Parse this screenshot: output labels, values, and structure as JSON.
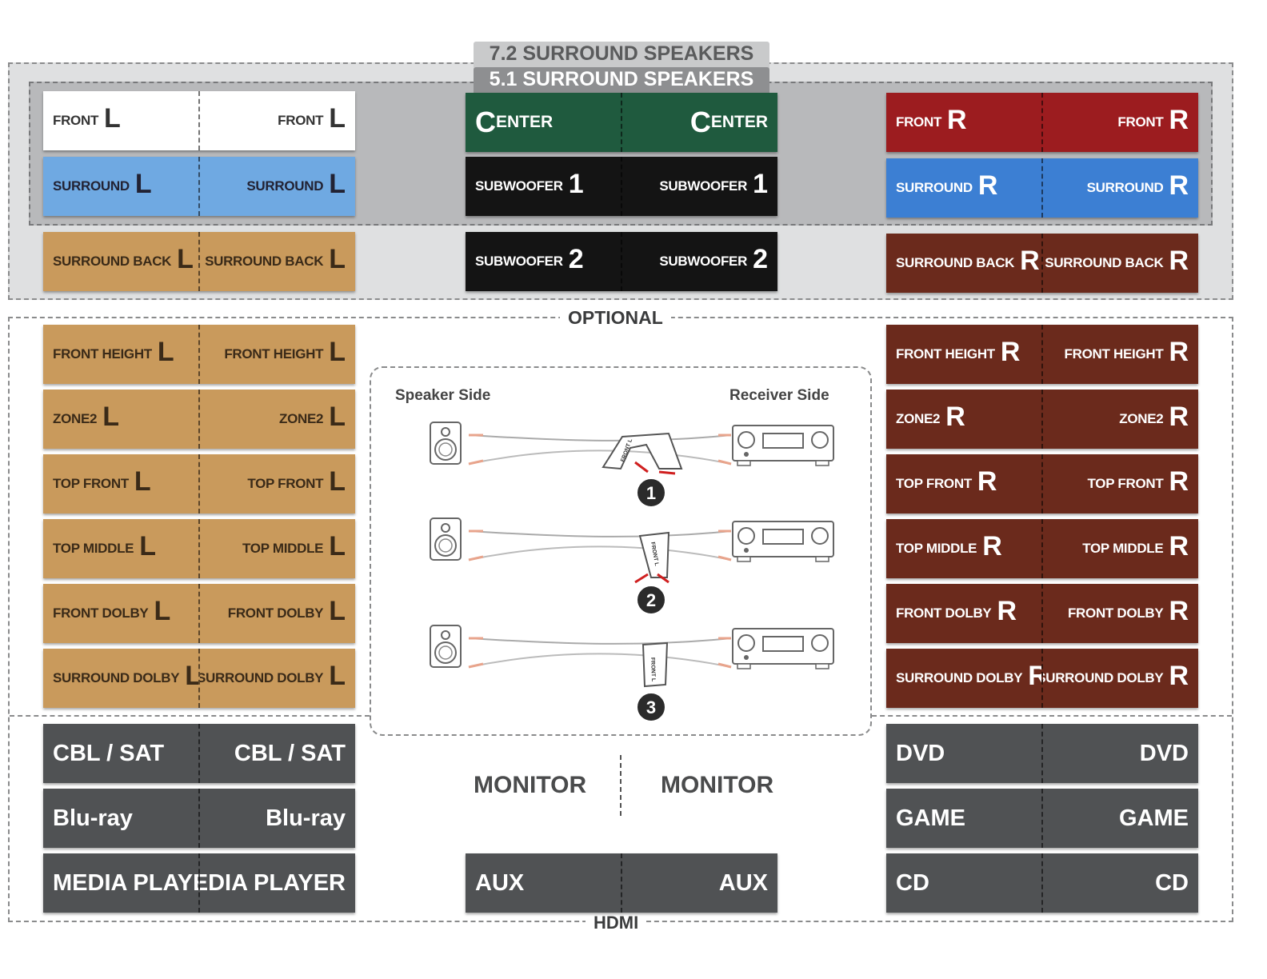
{
  "headers": {
    "seven_two": "7.2 SURROUND SPEAKERS",
    "five_one": "5.1 SURROUND SPEAKERS"
  },
  "sections": {
    "optional": "OPTIONAL",
    "hdmi": "HDMI"
  },
  "labels": {
    "front_l": {
      "text": "FRONT",
      "letter": "L"
    },
    "surround_l": {
      "text": "SURROUND",
      "letter": "L"
    },
    "surround_back_l": {
      "text": "SURROUND BACK",
      "letter": "L"
    },
    "center": {
      "text": "CENTER"
    },
    "sub1": {
      "text": "SUBWOOFER",
      "letter": "1"
    },
    "sub2": {
      "text": "SUBWOOFER",
      "letter": "2"
    },
    "front_r": {
      "text": "FRONT",
      "letter": "R"
    },
    "surround_r": {
      "text": "SURROUND",
      "letter": "R"
    },
    "surround_back_r": {
      "text": "SURROUND BACK",
      "letter": "R"
    }
  },
  "optional_labels": [
    "FRONT HEIGHT",
    "ZONE2",
    "TOP FRONT",
    "TOP MIDDLE",
    "FRONT DOLBY",
    "SURROUND DOLBY"
  ],
  "letters": {
    "left": "L",
    "right": "R"
  },
  "sources_left": [
    "CBL / SAT",
    "Blu-ray",
    "MEDIA PLAYER"
  ],
  "sources_right": [
    "DVD",
    "GAME",
    "CD"
  ],
  "monitor": "MONITOR",
  "aux": "AUX",
  "diagram": {
    "speaker_side": "Speaker Side",
    "receiver_side": "Receiver Side",
    "steps": [
      "1",
      "2",
      "3"
    ],
    "tag_text": "FRONT L"
  },
  "colors": {
    "white": "#ffffff",
    "blue": "#6fa9e2",
    "tan": "#c99a5c",
    "green": "#1f5a3e",
    "black": "#141414",
    "red": "#9c1c1f",
    "blue_r": "#3c7fd3",
    "brown": "#6b2a1c",
    "gray": "#505254"
  }
}
